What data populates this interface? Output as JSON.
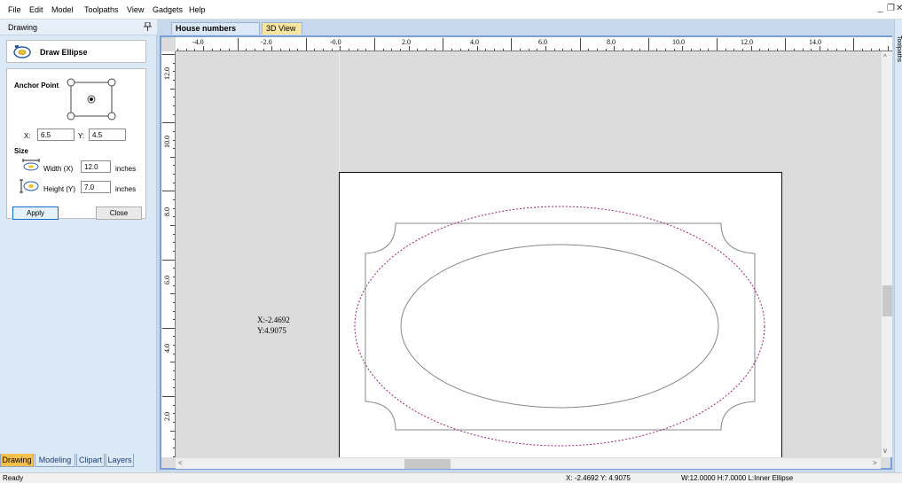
{
  "menu": [
    "File",
    "Edit",
    "Model",
    "Toolpaths",
    "View",
    "Gadgets",
    "Help"
  ],
  "window_controls": {
    "minimize": "_",
    "restore": "❐",
    "close": "✕"
  },
  "left_panel": {
    "title": "Drawing",
    "pin_icon": "pushpin-icon",
    "tool_name": "Draw Ellipse",
    "tool_icon": "ellipse-tool-icon",
    "anchor_heading": "Anchor Point",
    "x_label": "X:",
    "x_value": "6.5",
    "y_label": "Y:",
    "y_value": "4.5",
    "size_heading": "Size",
    "width_label": "Width (X)",
    "width_value": "12.0",
    "height_label": "Height (Y)",
    "height_value": "7.0",
    "units": "inches",
    "apply": "Apply",
    "close": "Close"
  },
  "bottom_tabs": [
    "Drawing",
    "Modeling",
    "Clipart",
    "Layers"
  ],
  "doc_tabs": [
    "House numbers Plaque",
    "3D View"
  ],
  "ruler_top": [
    "-4.0",
    "-2.0",
    "-0.0",
    "2.0",
    "4.0",
    "6.0",
    "8.0",
    "10.0",
    "12.0",
    "14.0"
  ],
  "ruler_left": [
    "12.0",
    "10.0",
    "8.0",
    "6.0",
    "4.0",
    "2.0"
  ],
  "cursor_readout": {
    "x": "X:-2.4692",
    "y": "Y:4.9075"
  },
  "right_strip_label": "Toolpaths",
  "status": {
    "ready": "Ready",
    "cursor": "X: -2.4692 Y:  4.9075",
    "size": "W:12.0000   H:7.0000   L:Inner Ellipse"
  },
  "colors": {
    "panel_bg": "#dbe8f5",
    "active_tab": "#f6c14a",
    "viewport_border": "#7a9fd6",
    "selection_dashes": "#a0207a"
  }
}
